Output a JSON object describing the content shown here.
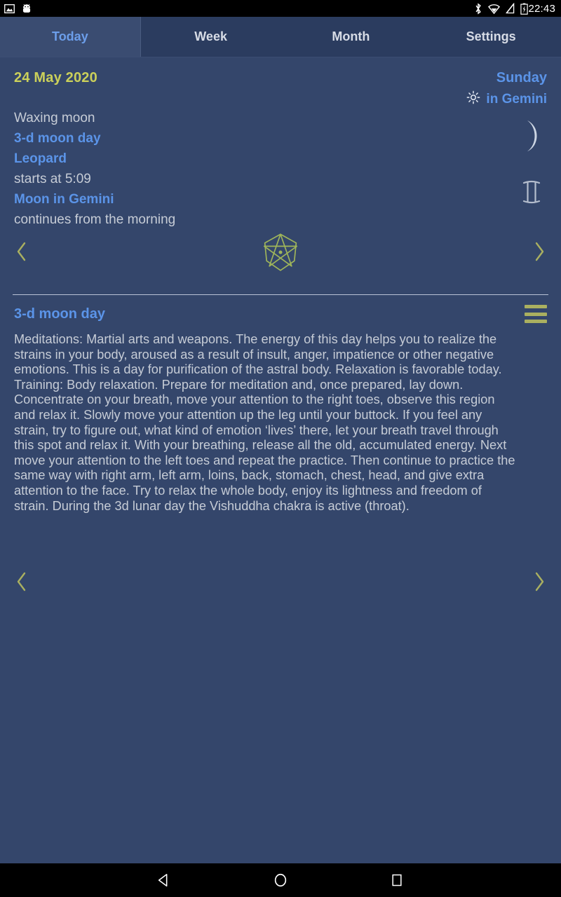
{
  "statusbar": {
    "time": "22:43",
    "left_icons": [
      "image-icon",
      "android-head-icon"
    ],
    "right_icons": [
      "bluetooth-icon",
      "wifi-icon",
      "signal-icon",
      "battery-charging-icon"
    ]
  },
  "tabs": [
    {
      "label": "Today",
      "active": true
    },
    {
      "label": "Week",
      "active": false
    },
    {
      "label": "Month",
      "active": false
    },
    {
      "label": "Settings",
      "active": false
    }
  ],
  "header": {
    "date": "24 May 2020",
    "weekday": "Sunday",
    "sun_sign": "in Gemini",
    "sun_icon": "sun-icon"
  },
  "info": {
    "phase": "Waxing moon",
    "moon_day": "3-d moon day",
    "symbol_name": "Leopard",
    "starts_at": "starts at 5:09",
    "moon_sign": "Moon in Gemini",
    "moon_sign_note": "continues from the morning",
    "moon_glyph": "waxing-crescent-moon-icon",
    "zodiac_glyph": "gemini-zodiac-icon"
  },
  "star_nav": {
    "star_icon": "seven-pointed-star-icon",
    "prev_icon": "chevron-left-icon",
    "next_icon": "chevron-right-icon"
  },
  "description": {
    "title": "3-d moon day",
    "menu_icon": "hamburger-menu-icon",
    "body": "Meditations: Martial arts and weapons. The energy of this day helps you to realize the strains in your body, aroused as a result of insult, anger, impatience or other negative emotions. This is a day for purification of the astral body. Relaxation is favorable today. Training: Body relaxation. Prepare for meditation and, once prepared, lay down. Concentrate on your breath, move your attention to the right toes, observe this region and relax it. Slowly move your attention up the leg until your buttock. If you feel any strain, try to figure out, what kind of emotion ‘lives’ there, let your breath travel through this spot and relax it. With your breathing, release all the old, accumulated energy. Next move your attention to the left toes and repeat the practice. Then continue to practice the same way with right arm, left arm, loins, back, stomach, chest, head, and give extra attention to the face. Try to relax the whole body, enjoy its lightness and freedom of strain. During the 3d lunar day the Vishuddha chakra is active (throat)."
  },
  "bottom_nav": {
    "prev_icon": "chevron-left-icon",
    "next_icon": "chevron-right-icon"
  },
  "system_nav": {
    "back": "back-triangle-icon",
    "home": "home-circle-icon",
    "recents": "recents-square-icon"
  },
  "colors": {
    "background": "#34466b",
    "tab_bar": "#2b3c5f",
    "tab_active_bg": "#3a4c71",
    "accent_blue": "#5b94e8",
    "accent_yellow": "#cbd05a",
    "accent_olive": "#aab060",
    "text_muted": "#c6ccd6"
  }
}
